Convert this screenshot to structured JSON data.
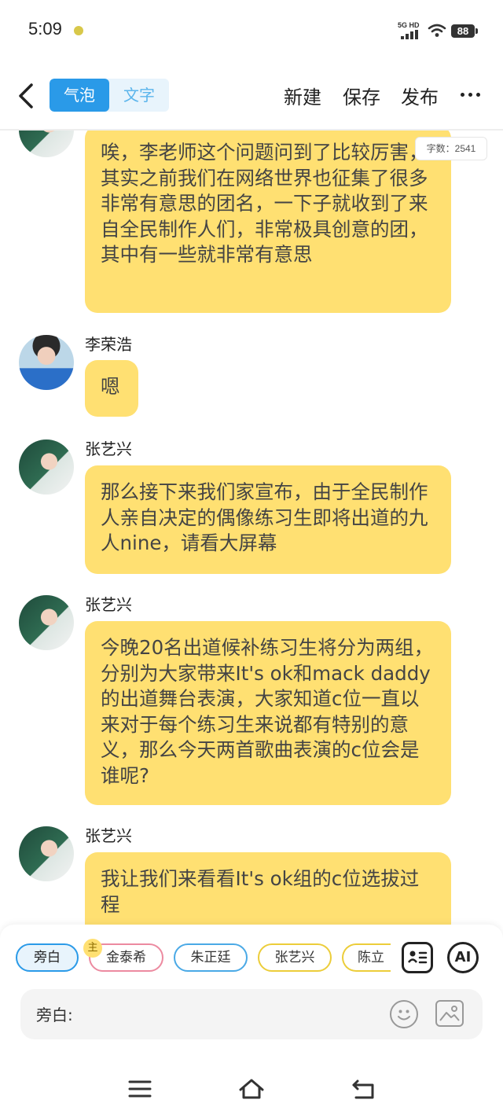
{
  "status_bar": {
    "time": "5:09",
    "network": "5G HD",
    "battery": "88"
  },
  "header": {
    "tabs": [
      {
        "label": "气泡",
        "active": true
      },
      {
        "label": "文字",
        "active": false
      }
    ],
    "actions": [
      "新建",
      "保存",
      "发布"
    ],
    "more_icon": "more-horizontal-icon"
  },
  "word_count": "字数：2541",
  "messages": [
    {
      "speaker": "",
      "avatar": "avatar-zhangyixing",
      "text": "唉，李老师这个问题问到了比较厉害，其实之前我们在网络世界也征集了很多非常有意思的团名，一下子就收到了来自全民制作人们，非常极具创意的团，其中有一些就非常有意思"
    },
    {
      "speaker": "李荣浩",
      "avatar": "avatar-lironghao",
      "text": "嗯"
    },
    {
      "speaker": "张艺兴",
      "avatar": "avatar-zhangyixing",
      "text": "那么接下来我们家宣布，由于全民制作人亲自决定的偶像练习生即将出道的九人nine，请看大屏幕"
    },
    {
      "speaker": "张艺兴",
      "avatar": "avatar-zhangyixing",
      "text": "今晚20名出道候补练习生将分为两组，分别为大家带来It's ok和mack daddy的出道舞台表演，大家知道c位一直以来对于每个练习生来说都有特别的意义，那么今天两首歌曲表演的c位会是谁呢?"
    },
    {
      "speaker": "张艺兴",
      "avatar": "avatar-zhangyixing",
      "text": "我让我们来看看It's ok组的c位选拔过程"
    }
  ],
  "roles": {
    "narrator": "旁白",
    "host_badge": "主",
    "chips": [
      "金泰希",
      "朱正廷",
      "张艺兴",
      "陈立"
    ]
  },
  "tools": {
    "ai_label": "AI"
  },
  "input": {
    "label": "旁白:"
  }
}
